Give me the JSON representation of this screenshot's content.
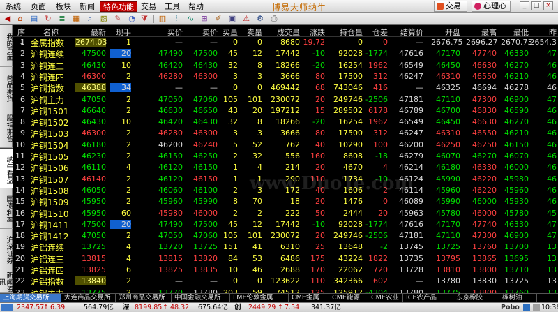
{
  "menu": {
    "items": [
      "系统",
      "页面",
      "板块",
      "新闻",
      "特色功能",
      "交易",
      "工具",
      "帮助"
    ],
    "active_index": 4,
    "app_title": "博易大师纳牛",
    "trade_label": "交易",
    "care_label": "心理心"
  },
  "sidebar": {
    "tabs": [
      "我的页面",
      "商品期货",
      "股指期货",
      "纳牛看盘",
      "国债利率",
      "沪深证券",
      "新闻资讯"
    ],
    "active_index": 3
  },
  "columns": [
    "序↓",
    "名称",
    "最新",
    "现手",
    "买价",
    "卖价",
    "买量",
    "卖量",
    "成交量",
    "涨跌",
    "持仓量",
    "仓差",
    "结算价",
    "开盘",
    "最高",
    "最低",
    "昨"
  ],
  "rows": [
    [
      "1",
      "金属指数",
      "2674.03",
      "1",
      "—",
      "—",
      "0",
      "0",
      "8680",
      "19.72",
      "0",
      "0",
      "—",
      "2676.75",
      "2696.27",
      "2670.73",
      "2654.3"
    ],
    [
      "2",
      "沪铜连续",
      "47500",
      "20",
      "47490",
      "47500",
      "45",
      "12",
      "17442",
      "-10",
      "92028",
      "-1774",
      "47616",
      "47170",
      "47740",
      "46330",
      "47"
    ],
    [
      "3",
      "沪铜连三",
      "46430",
      "10",
      "46420",
      "46430",
      "32",
      "8",
      "18266",
      "-20",
      "16254",
      "1962",
      "46549",
      "46450",
      "46630",
      "46270",
      "46"
    ],
    [
      "4",
      "沪铜连四",
      "46300",
      "2",
      "46280",
      "46300",
      "3",
      "3",
      "3666",
      "80",
      "17500",
      "312",
      "46247",
      "46310",
      "46550",
      "46210",
      "46"
    ],
    [
      "5",
      "沪铜指数",
      "46388",
      "34",
      "—",
      "—",
      "0",
      "0",
      "469442",
      "68",
      "743046",
      "416",
      "—",
      "46325",
      "46694",
      "46278",
      "46"
    ],
    [
      "6",
      "沪铜主力",
      "47050",
      "2",
      "47050",
      "47060",
      "105",
      "101",
      "230072",
      "20",
      "249746",
      "-2506",
      "47181",
      "47110",
      "47300",
      "46900",
      "47"
    ],
    [
      "7",
      "沪铜1501",
      "46640",
      "2",
      "46630",
      "46650",
      "43",
      "20",
      "197212",
      "15",
      "289502",
      "6178",
      "46789",
      "46700",
      "46830",
      "46590",
      "46"
    ],
    [
      "8",
      "沪铜1502",
      "46430",
      "10",
      "46420",
      "46430",
      "32",
      "8",
      "18266",
      "-20",
      "16254",
      "1962",
      "46549",
      "46450",
      "46630",
      "46270",
      "46"
    ],
    [
      "9",
      "沪铜1503",
      "46300",
      "2",
      "46280",
      "46300",
      "3",
      "3",
      "3666",
      "80",
      "17500",
      "312",
      "46247",
      "46310",
      "46550",
      "46210",
      "46"
    ],
    [
      "10",
      "沪铜1504",
      "46180",
      "2",
      "46200",
      "46240",
      "5",
      "52",
      "762",
      "40",
      "10290",
      "100",
      "46200",
      "46250",
      "46250",
      "46150",
      "46"
    ],
    [
      "11",
      "沪铜1505",
      "46230",
      "2",
      "46150",
      "46250",
      "2",
      "32",
      "556",
      "160",
      "8608",
      "-18",
      "46279",
      "46070",
      "46270",
      "46070",
      "46"
    ],
    [
      "12",
      "沪铜1506",
      "46110",
      "4",
      "46120",
      "46150",
      "1",
      "4",
      "214",
      "20",
      "4670",
      "4",
      "46214",
      "46180",
      "46330",
      "46000",
      "46"
    ],
    [
      "13",
      "沪铜1507",
      "46140",
      "2",
      "46120",
      "46150",
      "1",
      "1",
      "290",
      "110",
      "1734",
      "-10",
      "46124",
      "45990",
      "46220",
      "45980",
      "46"
    ],
    [
      "14",
      "沪铜1508",
      "46050",
      "2",
      "46060",
      "46100",
      "2",
      "3",
      "172",
      "40",
      "1606",
      "2",
      "46114",
      "45960",
      "46220",
      "45960",
      "46"
    ],
    [
      "15",
      "沪铜1509",
      "45950",
      "2",
      "45960",
      "45990",
      "8",
      "70",
      "18",
      "20",
      "1476",
      "0",
      "46089",
      "45990",
      "46000",
      "45930",
      "46"
    ],
    [
      "16",
      "沪铜1510",
      "45950",
      "60",
      "45980",
      "46000",
      "2",
      "2",
      "222",
      "50",
      "2444",
      "20",
      "45963",
      "45780",
      "46000",
      "45780",
      "45"
    ],
    [
      "17",
      "沪铜1411",
      "47500",
      "20",
      "47490",
      "47500",
      "45",
      "12",
      "17442",
      "-10",
      "92028",
      "-1774",
      "47616",
      "47170",
      "47740",
      "46330",
      "47"
    ],
    [
      "18",
      "沪铜1412",
      "47050",
      "2",
      "47050",
      "47060",
      "105",
      "101",
      "230072",
      "20",
      "249746",
      "-2506",
      "47181",
      "47110",
      "47300",
      "46900",
      "47"
    ],
    [
      "19",
      "沪铝连续",
      "13725",
      "4",
      "13720",
      "13725",
      "151",
      "41",
      "6310",
      "25",
      "13648",
      "-2",
      "13745",
      "13725",
      "13760",
      "13700",
      "13"
    ],
    [
      "20",
      "沪铝连三",
      "13815",
      "4",
      "13815",
      "13820",
      "84",
      "53",
      "6486",
      "175",
      "43224",
      "1822",
      "13735",
      "13795",
      "13865",
      "13695",
      "13"
    ],
    [
      "21",
      "沪铝连四",
      "13825",
      "6",
      "13825",
      "13835",
      "10",
      "46",
      "2688",
      "170",
      "22062",
      "720",
      "13728",
      "13810",
      "13800",
      "13710",
      "13"
    ],
    [
      "22",
      "沪铝指数",
      "13840",
      "2",
      "—",
      "—",
      "0",
      "0",
      "123622",
      "110",
      "342366",
      "602",
      "—",
      "13780",
      "13830",
      "13725",
      "13"
    ],
    [
      "23",
      "沪铝主力",
      "13775",
      "2",
      "13770",
      "13780",
      "203",
      "59",
      "74512",
      "125",
      "125912",
      "-4304",
      "13780",
      "13775",
      "13800",
      "13760",
      "13"
    ]
  ],
  "tabs": [
    "上海期货交易所",
    "大连商品交易所",
    "郑州商品交易所",
    "中国金融交易所",
    "LME伦敦金属",
    "CME金属",
    "CME能源",
    "CME农业",
    "ICE农产品",
    "东京橡胶",
    "橡树油"
  ],
  "active_tab": 0,
  "status": {
    "idx1": "2347.57",
    "d1": "6.39",
    "v1": "564.79亿",
    "idx2": "8199.85",
    "d2": "48.32",
    "v2": "675.64亿",
    "idx3": "2449.29",
    "d3": "7.54",
    "v3": "341.37亿",
    "brand": "Pobo",
    "time": "10:36"
  },
  "watermark": "www.DuoTe.com",
  "colors": {
    "up": "#ff4040",
    "down": "#00e000",
    "flat": "#d8d8d8",
    "name": "#ffff40",
    "active_tab": "#3c78c8"
  }
}
